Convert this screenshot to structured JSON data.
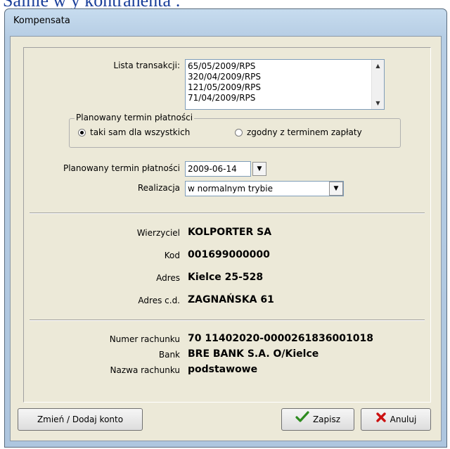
{
  "background": {
    "text": "Salnie w y kontrahenta :"
  },
  "window": {
    "title": "Kompensata"
  },
  "transactions": {
    "label": "Lista transakcji:",
    "items": [
      "65/05/2009/RPS",
      "320/04/2009/RPS",
      "121/05/2009/RPS",
      "71/04/2009/RPS"
    ]
  },
  "payment_group": {
    "legend": "Planowany termin płatności",
    "option_same": "taki sam dla wszystkich",
    "option_match": "zgodny z terminem zapłaty",
    "selected": "taki sam dla wszystkich"
  },
  "due_date": {
    "label": "Planowany termin płatności",
    "value": "2009-06-14"
  },
  "realization": {
    "label": "Realizacja",
    "value": "w normalnym trybie"
  },
  "creditor": {
    "name_label": "Wierzyciel",
    "name": "KOLPORTER SA",
    "code_label": "Kod",
    "code": "001699000000",
    "address_label": "Adres",
    "address": "Kielce 25-528",
    "address2_label": "Adres c.d.",
    "address2": "ZAGNAŃSKA 61"
  },
  "account": {
    "number_label": "Numer rachunku",
    "number": "70 11402020-0000261836001018",
    "bank_label": "Bank",
    "bank": "BRE BANK S.A. O/Kielce",
    "name_label": "Nazwa rachunku",
    "name": "podstawowe"
  },
  "buttons": {
    "change_account": "Zmień / Dodaj konto",
    "save": "Zapisz",
    "cancel": "Anuluj"
  },
  "colors": {
    "save_icon": "#2e8b1f",
    "cancel_icon": "#cc1111"
  }
}
